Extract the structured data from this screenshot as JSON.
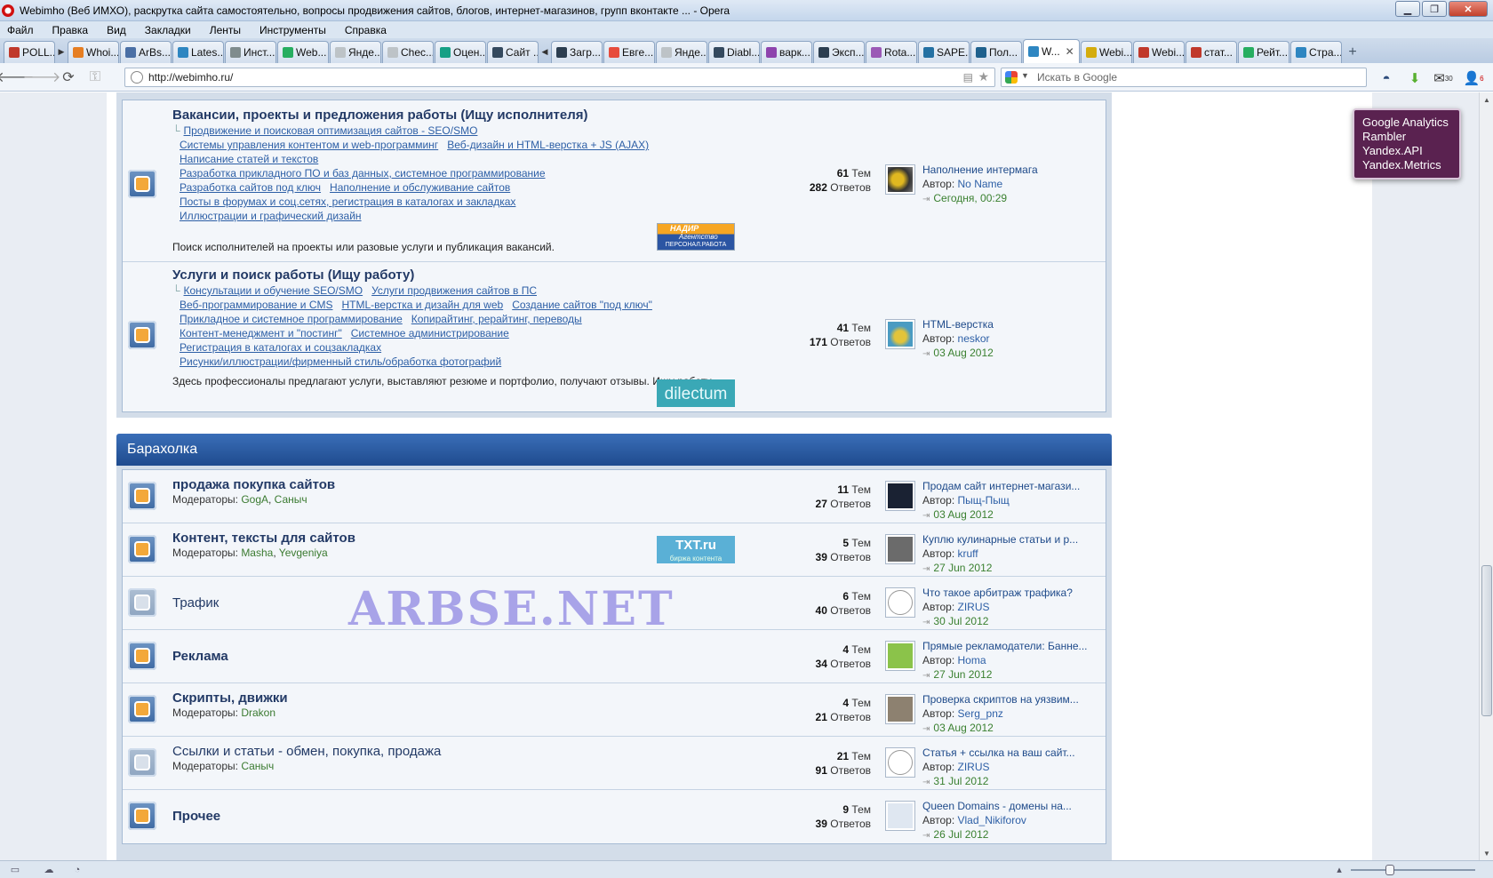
{
  "window": {
    "title": "Webimho (Веб ИМХО), раскрутка сайта самостоятельно, вопросы продвижения сайтов, блогов, интернет-магазинов, групп вконтакте ... - Opera"
  },
  "menu": [
    "Файл",
    "Правка",
    "Вид",
    "Закладки",
    "Ленты",
    "Инструменты",
    "Справка"
  ],
  "tabs": [
    {
      "label": "POLL...",
      "color": "#c0392b"
    },
    {
      "label": "Whoi...",
      "color": "#e67e22"
    },
    {
      "label": "ArBs...",
      "color": "#4a6fa5"
    },
    {
      "label": "Lates...",
      "color": "#2e86c1"
    },
    {
      "label": "Инст...",
      "color": "#7f8c8d"
    },
    {
      "label": "Web...",
      "color": "#27ae60"
    },
    {
      "label": "Янде...",
      "color": "#bdc3c7"
    },
    {
      "label": "Chec...",
      "color": "#bdc3c7"
    },
    {
      "label": "Оцен...",
      "color": "#16a085"
    },
    {
      "label": "Сайт ...",
      "color": "#34495e"
    },
    {
      "label": "Загр...",
      "color": "#2c3e50"
    },
    {
      "label": "Евге...",
      "color": "#e74c3c"
    },
    {
      "label": "Янде...",
      "color": "#bdc3c7"
    },
    {
      "label": "Diabl...",
      "color": "#34495e"
    },
    {
      "label": "варк...",
      "color": "#8e44ad"
    },
    {
      "label": "Эксп...",
      "color": "#2c3e50"
    },
    {
      "label": "Rota...",
      "color": "#9b59b6"
    },
    {
      "label": "SAPE...",
      "color": "#2471a3"
    },
    {
      "label": "Пол...",
      "color": "#1f618d"
    },
    {
      "label": "W...",
      "color": "#2e86c1",
      "active": true
    },
    {
      "label": "Webi...",
      "color": "#d4ac0d"
    },
    {
      "label": "Webi...",
      "color": "#c0392b"
    },
    {
      "label": "стат...",
      "color": "#c0392b"
    },
    {
      "label": "Рейт...",
      "color": "#27ae60"
    },
    {
      "label": "Стра...",
      "color": "#2e86c1"
    }
  ],
  "address": {
    "url": "http://webimho.ru/"
  },
  "search": {
    "placeholder": "Искать в Google"
  },
  "toolbar_badges": {
    "mail": "30",
    "users": "6"
  },
  "tooltip": [
    "Google Analytics",
    "Rambler",
    "Yandex.API",
    "Yandex.Metrics"
  ],
  "forum1": {
    "name": "Вакансии, проекты и предложения работы (Ищу исполнителя)",
    "subs": [
      [
        "Продвижение и поисковая оптимизация сайтов - SEO/SMO"
      ],
      [
        "Системы управления контентом и web-программинг",
        "Веб-дизайн и HTML-верстка + JS (AJAX)"
      ],
      [
        "Написание статей и текстов"
      ],
      [
        "Разработка прикладного ПО и баз данных, системное программирование"
      ],
      [
        "Разработка сайтов под ключ",
        "Наполнение и обслуживание сайтов"
      ],
      [
        "Посты в форумах и соц.сетях, регистрация в каталогах и закладках"
      ],
      [
        "Иллюстрации и графический дизайн"
      ]
    ],
    "desc": "Поиск исполнителей на проекты или разовые услуги и публикация вакансий.",
    "topics": "61",
    "replies": "282",
    "last_title": "Наполнение интермага",
    "last_author": "No Name",
    "last_date": "Сегодня, 00:29",
    "banner_top": "НАДИР",
    "banner_mid": "Агентство",
    "banner_bot": "ПЕРСОНАЛ.РАБОТА"
  },
  "forum2": {
    "name": "Услуги и поиск работы (Ищу работу)",
    "subs": [
      [
        "Консультации и обучение SEO/SMO",
        "Услуги продвижения сайтов в ПС"
      ],
      [
        "Веб-программирование и CMS",
        "HTML-верстка и дизайн для web",
        "Создание сайтов \"под ключ\""
      ],
      [
        "Прикладное и системное программирование",
        "Копирайтинг, рерайтинг, переводы"
      ],
      [
        "Контент-менеджмент и \"постинг\"",
        "Системное администрирование"
      ],
      [
        "Регистрация в каталогах и соцзакладках"
      ],
      [
        "Рисунки/иллюстрации/фирменный стиль/обработка фотографий"
      ]
    ],
    "desc": "Здесь профессионалы предлагают услуги, выставляют резюме и портфолио, получают отзывы. Ищу работу.",
    "topics": "41",
    "replies": "171",
    "last_title": "HTML-верстка",
    "last_author": "neskor",
    "last_date": "03 Aug 2012",
    "banner": "dilectum"
  },
  "labels": {
    "topics": "Тем",
    "replies": "Ответов",
    "author": "Автор:",
    "mods": "Модераторы:"
  },
  "category": {
    "title": "Барахолка"
  },
  "market": [
    {
      "name": "продажа покупка сайтов",
      "mods": [
        "GogA",
        "Саныч"
      ],
      "topics": "11",
      "replies": "27",
      "last_title": "Продам сайт интернет-магази...",
      "last_author": "Пыщ-Пыщ",
      "last_date": "03 Aug 2012",
      "icon": "new",
      "avatar": "#1a2233"
    },
    {
      "name": "Контент, тексты для сайтов",
      "mods": [
        "Masha",
        "Yevgeniya"
      ],
      "topics": "5",
      "replies": "39",
      "last_title": "Куплю кулинарные статьи и р...",
      "last_author": "kruff",
      "last_date": "27 Jun 2012",
      "icon": "new",
      "avatar": "#6b6b6b",
      "banner": "TXT.ru",
      "banner_sub": "биржа контента"
    },
    {
      "name": "Трафик",
      "mods": [],
      "topics": "6",
      "replies": "40",
      "last_title": "Что такое арбитраж трафика?",
      "last_author": "ZIRUS",
      "last_date": "30 Jul 2012",
      "icon": "read",
      "avatar": "#ffffff",
      "plain": true
    },
    {
      "name": "Реклама",
      "mods": [],
      "topics": "4",
      "replies": "34",
      "last_title": "Прямые рекламодатели: Банне...",
      "last_author": "Homa",
      "last_date": "27 Jun 2012",
      "icon": "new",
      "avatar": "#8bc34a"
    },
    {
      "name": "Скрипты, движки",
      "mods": [
        "Drakon"
      ],
      "topics": "4",
      "replies": "21",
      "last_title": "Проверка скриптов на уязвим...",
      "last_author": "Serg_pnz",
      "last_date": "03 Aug 2012",
      "icon": "new",
      "avatar": "#8d8170"
    },
    {
      "name": "Ссылки и статьи - обмен, покупка, продажа",
      "mods": [
        "Саныч"
      ],
      "topics": "21",
      "replies": "91",
      "last_title": "Статья + ссылка на ваш сайт...",
      "last_author": "ZIRUS",
      "last_date": "31 Jul 2012",
      "icon": "read",
      "avatar": "#ffffff",
      "plain": true
    },
    {
      "name": "Прочее",
      "mods": [],
      "topics": "9",
      "replies": "39",
      "last_title": "Queen Domains - домены на...",
      "last_author": "Vlad_Nikiforov",
      "last_date": "26 Jul 2012",
      "icon": "new",
      "avatar": "#dfe7f1"
    }
  ],
  "watermark": "ARBSE.NET",
  "zoom": {
    "level": 0.3
  }
}
